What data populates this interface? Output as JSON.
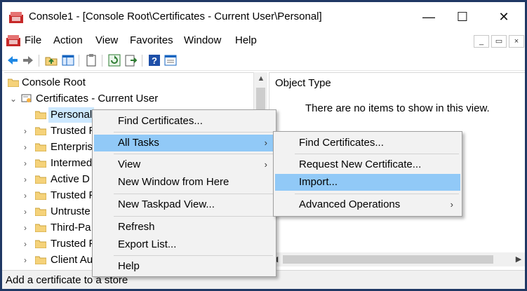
{
  "window": {
    "title": "Console1 - [Console Root\\Certificates - Current User\\Personal]",
    "minimize": "—",
    "maximize": "☐",
    "close": "✕"
  },
  "menubar": {
    "items": [
      "File",
      "Action",
      "View",
      "Favorites",
      "Window",
      "Help"
    ],
    "mdi_minimize": "_",
    "mdi_restore": "▭",
    "mdi_close": "×"
  },
  "toolbar": {
    "buttons": [
      "back-icon",
      "forward-icon",
      "up-folder-icon",
      "show-hide-tree-icon",
      "clipboard-icon",
      "refresh-icon",
      "export-icon",
      "help-icon",
      "properties-icon"
    ]
  },
  "tree": {
    "root": "Console Root",
    "certificates": "Certificates - Current User",
    "children": [
      "Personal",
      "Trusted R",
      "Enterpris",
      "Intermed",
      "Active D",
      "Trusted P",
      "Untruste",
      "Third-Pa",
      "Trusted P",
      "Client Au"
    ]
  },
  "list": {
    "column_header": "Object Type",
    "empty_message": "There are no items to show in this view."
  },
  "status": {
    "text": "Add a certificate to a store"
  },
  "context_menu": {
    "items": [
      "Find Certificates...",
      "All Tasks",
      "View",
      "New Window from Here",
      "New Taskpad View...",
      "Refresh",
      "Export List...",
      "Help"
    ]
  },
  "submenu": {
    "items": [
      "Find Certificates...",
      "Request New Certificate...",
      "Import...",
      "Advanced Operations"
    ]
  },
  "colors": {
    "frame_border": "#1f3864",
    "menu_highlight": "#91c9f7",
    "tree_selection": "#cce8ff",
    "folder_fill": "#f5d27a"
  }
}
